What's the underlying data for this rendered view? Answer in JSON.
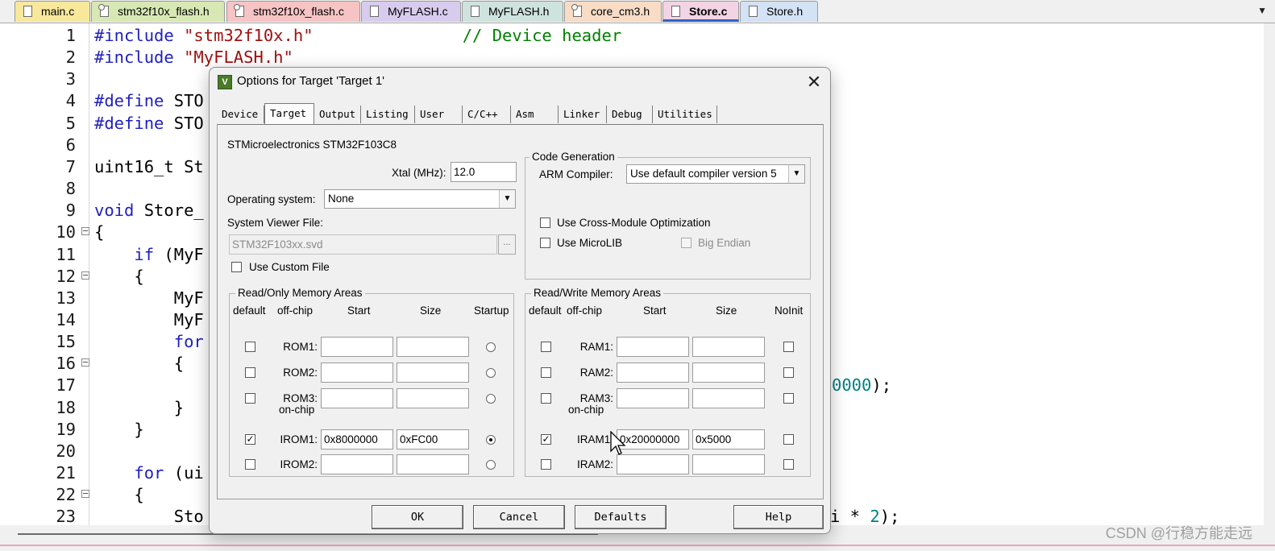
{
  "editor_tabs": [
    {
      "label": "main.c",
      "color": "#f7e89c",
      "icon": "file-icon"
    },
    {
      "label": "stm32f10x_flash.h",
      "color": "#d8e8b4",
      "icon": "header-file-icon"
    },
    {
      "label": "stm32f10x_flash.c",
      "color": "#f6c4c4",
      "icon": "header-file-icon"
    },
    {
      "label": "MyFLASH.c",
      "color": "#d8ccee",
      "icon": "file-icon"
    },
    {
      "label": "MyFLASH.h",
      "color": "#cfe3de",
      "icon": "file-icon"
    },
    {
      "label": "core_cm3.h",
      "color": "#f8dcc6",
      "icon": "header-file-icon"
    },
    {
      "label": "Store.c",
      "color": "#f2d4e4",
      "icon": "file-icon",
      "active": true
    },
    {
      "label": "Store.h",
      "color": "#d3e2f4",
      "icon": "file-icon"
    }
  ],
  "code_lines": [
    {
      "n": "1",
      "fold": false,
      "segs": [
        {
          "t": "#include ",
          "c": "kw"
        },
        {
          "t": "\"stm32f10x.h\"",
          "c": "str"
        },
        {
          "t": "               "
        },
        {
          "t": "// Device header",
          "c": "cmt"
        }
      ]
    },
    {
      "n": "2",
      "fold": false,
      "segs": [
        {
          "t": "#include ",
          "c": "kw"
        },
        {
          "t": "\"MyFLASH.h\"",
          "c": "str"
        }
      ]
    },
    {
      "n": "3",
      "fold": false,
      "segs": []
    },
    {
      "n": "4",
      "fold": false,
      "segs": [
        {
          "t": "#define ",
          "c": "kw"
        },
        {
          "t": "STO"
        }
      ]
    },
    {
      "n": "5",
      "fold": false,
      "segs": [
        {
          "t": "#define ",
          "c": "kw"
        },
        {
          "t": "STO"
        }
      ]
    },
    {
      "n": "6",
      "fold": false,
      "segs": []
    },
    {
      "n": "7",
      "fold": false,
      "segs": [
        {
          "t": "uint16_t St"
        }
      ]
    },
    {
      "n": "8",
      "fold": false,
      "segs": []
    },
    {
      "n": "9",
      "fold": false,
      "segs": [
        {
          "t": "void ",
          "c": "kw"
        },
        {
          "t": "Store_"
        }
      ]
    },
    {
      "n": "10",
      "fold": true,
      "segs": [
        {
          "t": "{"
        }
      ]
    },
    {
      "n": "11",
      "fold": false,
      "segs": [
        {
          "t": "    "
        },
        {
          "t": "if",
          "c": "kw"
        },
        {
          "t": " (MyF"
        }
      ]
    },
    {
      "n": "12",
      "fold": true,
      "segs": [
        {
          "t": "    {"
        }
      ]
    },
    {
      "n": "13",
      "fold": false,
      "segs": [
        {
          "t": "        MyF"
        }
      ]
    },
    {
      "n": "14",
      "fold": false,
      "segs": [
        {
          "t": "        MyF"
        }
      ]
    },
    {
      "n": "15",
      "fold": false,
      "segs": [
        {
          "t": "        "
        },
        {
          "t": "for",
          "c": "kw"
        }
      ]
    },
    {
      "n": "16",
      "fold": true,
      "segs": [
        {
          "t": "        {"
        }
      ]
    },
    {
      "n": "17",
      "fold": false,
      "segs": [],
      "tail": [
        {
          "t": "0000",
          "c": "num"
        },
        {
          "t": ");"
        }
      ]
    },
    {
      "n": "18",
      "fold": false,
      "segs": [
        {
          "t": "        }"
        }
      ]
    },
    {
      "n": "19",
      "fold": false,
      "segs": [
        {
          "t": "    }"
        }
      ]
    },
    {
      "n": "20",
      "fold": false,
      "segs": []
    },
    {
      "n": "21",
      "fold": false,
      "segs": [
        {
          "t": "    "
        },
        {
          "t": "for",
          "c": "kw"
        },
        {
          "t": " (ui"
        }
      ]
    },
    {
      "n": "22",
      "fold": true,
      "segs": [
        {
          "t": "    {"
        }
      ]
    },
    {
      "n": "23",
      "fold": false,
      "segs": [
        {
          "t": "        Sto"
        }
      ],
      "tail": [
        {
          "t": "i * "
        },
        {
          "t": "2",
          "c": "num"
        },
        {
          "t": ");"
        }
      ]
    }
  ],
  "watermark": "CSDN @行稳方能走远",
  "dialog": {
    "title": "Options for Target 'Target 1'",
    "close_label": "✕",
    "tabs": [
      "Device",
      "Target",
      "Output",
      "Listing",
      "User",
      "C/C++",
      "Asm",
      "Linker",
      "Debug",
      "Utilities"
    ],
    "active_tab": "Target",
    "device_name": "STMicroelectronics STM32F103C8",
    "xtal_label": "Xtal (MHz):",
    "xtal_value": "12.0",
    "os_label": "Operating system:",
    "os_value": "None",
    "svd_label": "System Viewer File:",
    "svd_value": "STM32F103xx.svd",
    "browse_label": "...",
    "custom_file_label": "Use Custom File",
    "custom_file_checked": false,
    "code_gen": {
      "title": "Code Generation",
      "compiler_label": "ARM Compiler:",
      "compiler_value": "Use default compiler version 5",
      "cross_module_label": "Use Cross-Module Optimization",
      "cross_module_checked": false,
      "microlib_label": "Use MicroLIB",
      "microlib_checked": false,
      "big_endian_label": "Big Endian",
      "big_endian_checked": false
    },
    "ro": {
      "title": "Read/Only Memory Areas",
      "headers": {
        "default": "default",
        "offchip": "off-chip",
        "start": "Start",
        "size": "Size",
        "last": "Startup"
      },
      "onchip_label": "on-chip",
      "rows": [
        {
          "label": "ROM1:",
          "default": false,
          "start": "",
          "size": "",
          "flag": false
        },
        {
          "label": "ROM2:",
          "default": false,
          "start": "",
          "size": "",
          "flag": false
        },
        {
          "label": "ROM3:",
          "default": false,
          "start": "",
          "size": "",
          "flag": false
        },
        {
          "label": "IROM1:",
          "default": true,
          "start": "0x8000000",
          "size": "0xFC00",
          "flag": true
        },
        {
          "label": "IROM2:",
          "default": false,
          "start": "",
          "size": "",
          "flag": false
        }
      ]
    },
    "rw": {
      "title": "Read/Write Memory Areas",
      "headers": {
        "default": "default",
        "offchip": "off-chip",
        "start": "Start",
        "size": "Size",
        "last": "NoInit"
      },
      "onchip_label": "on-chip",
      "rows": [
        {
          "label": "RAM1:",
          "default": false,
          "start": "",
          "size": "",
          "flag": false
        },
        {
          "label": "RAM2:",
          "default": false,
          "start": "",
          "size": "",
          "flag": false
        },
        {
          "label": "RAM3:",
          "default": false,
          "start": "",
          "size": "",
          "flag": false
        },
        {
          "label": "IRAM1:",
          "default": true,
          "start": "0x20000000",
          "size": "0x5000",
          "flag": false
        },
        {
          "label": "IRAM2:",
          "default": false,
          "start": "",
          "size": "",
          "flag": false
        }
      ]
    },
    "buttons": {
      "ok": "OK",
      "cancel": "Cancel",
      "defaults": "Defaults",
      "help": "Help"
    }
  }
}
